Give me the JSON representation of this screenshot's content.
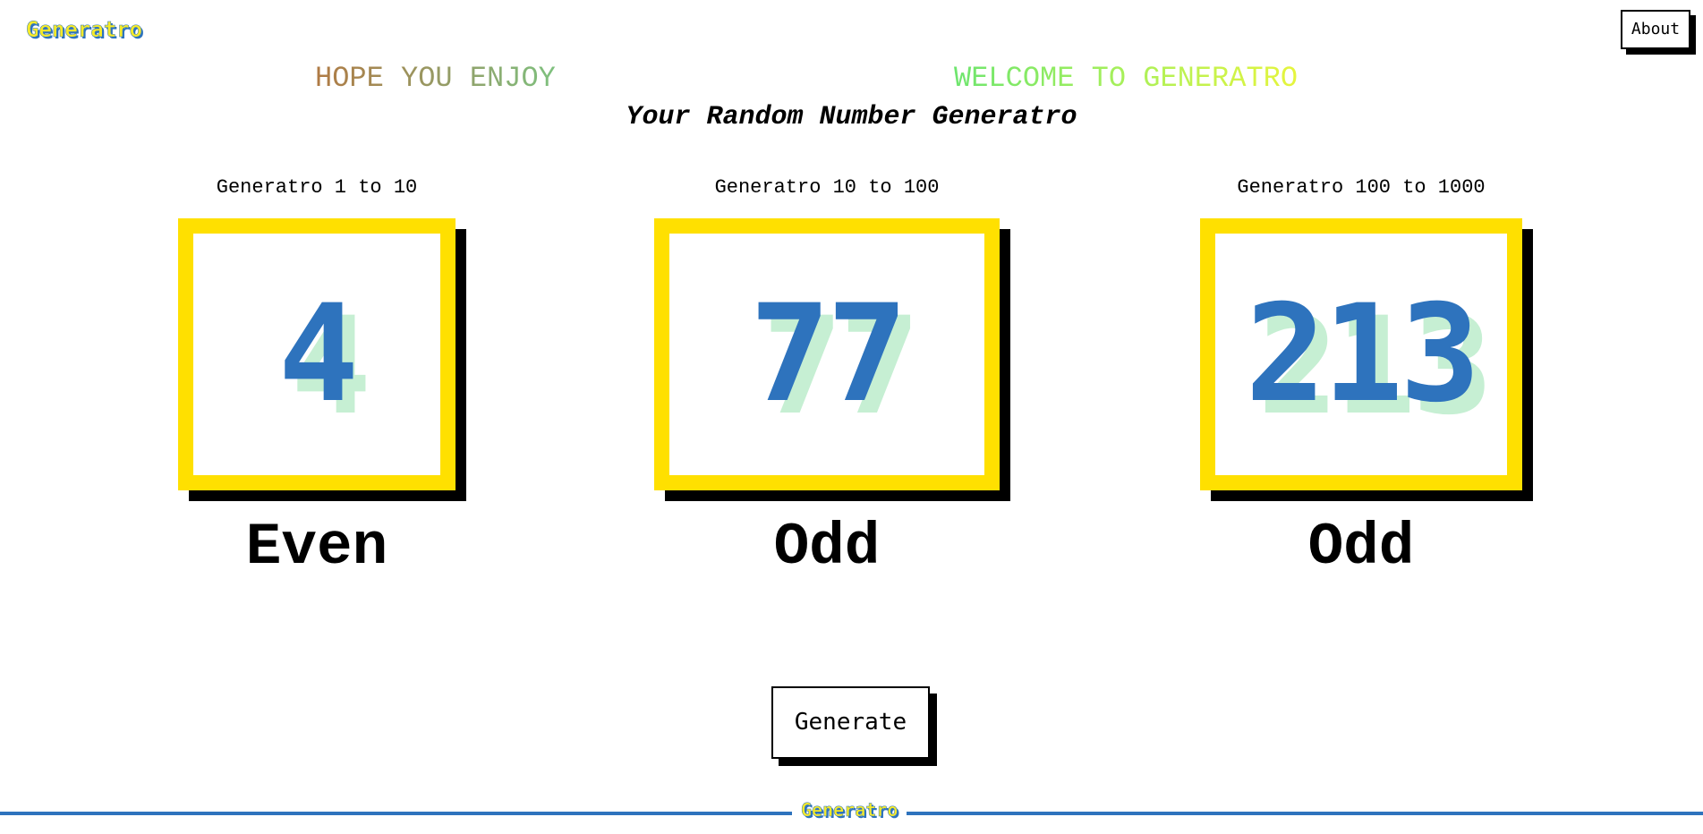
{
  "header": {
    "logo": "Generatro",
    "about_label": "About"
  },
  "banner": {
    "left_text": "HOPE YOU ENJOY",
    "right_text": "WELCOME TO GENERATRO"
  },
  "subtitle": "Your Random Number Generatro",
  "generators": [
    {
      "label": "Generatro 1 to 10",
      "value": "4",
      "parity": "Even"
    },
    {
      "label": "Generatro 10 to 100",
      "value": "77",
      "parity": "Odd"
    },
    {
      "label": "Generatro 100 to 1000",
      "value": "213",
      "parity": "Odd"
    }
  ],
  "actions": {
    "generate_label": "Generate"
  },
  "footer": {
    "logo": "Generatro"
  },
  "colors": {
    "accent_yellow": "#ffe000",
    "number_blue": "#2e73bd",
    "number_shadow_green": "#c6efd3",
    "footer_line": "#2e73bd"
  }
}
